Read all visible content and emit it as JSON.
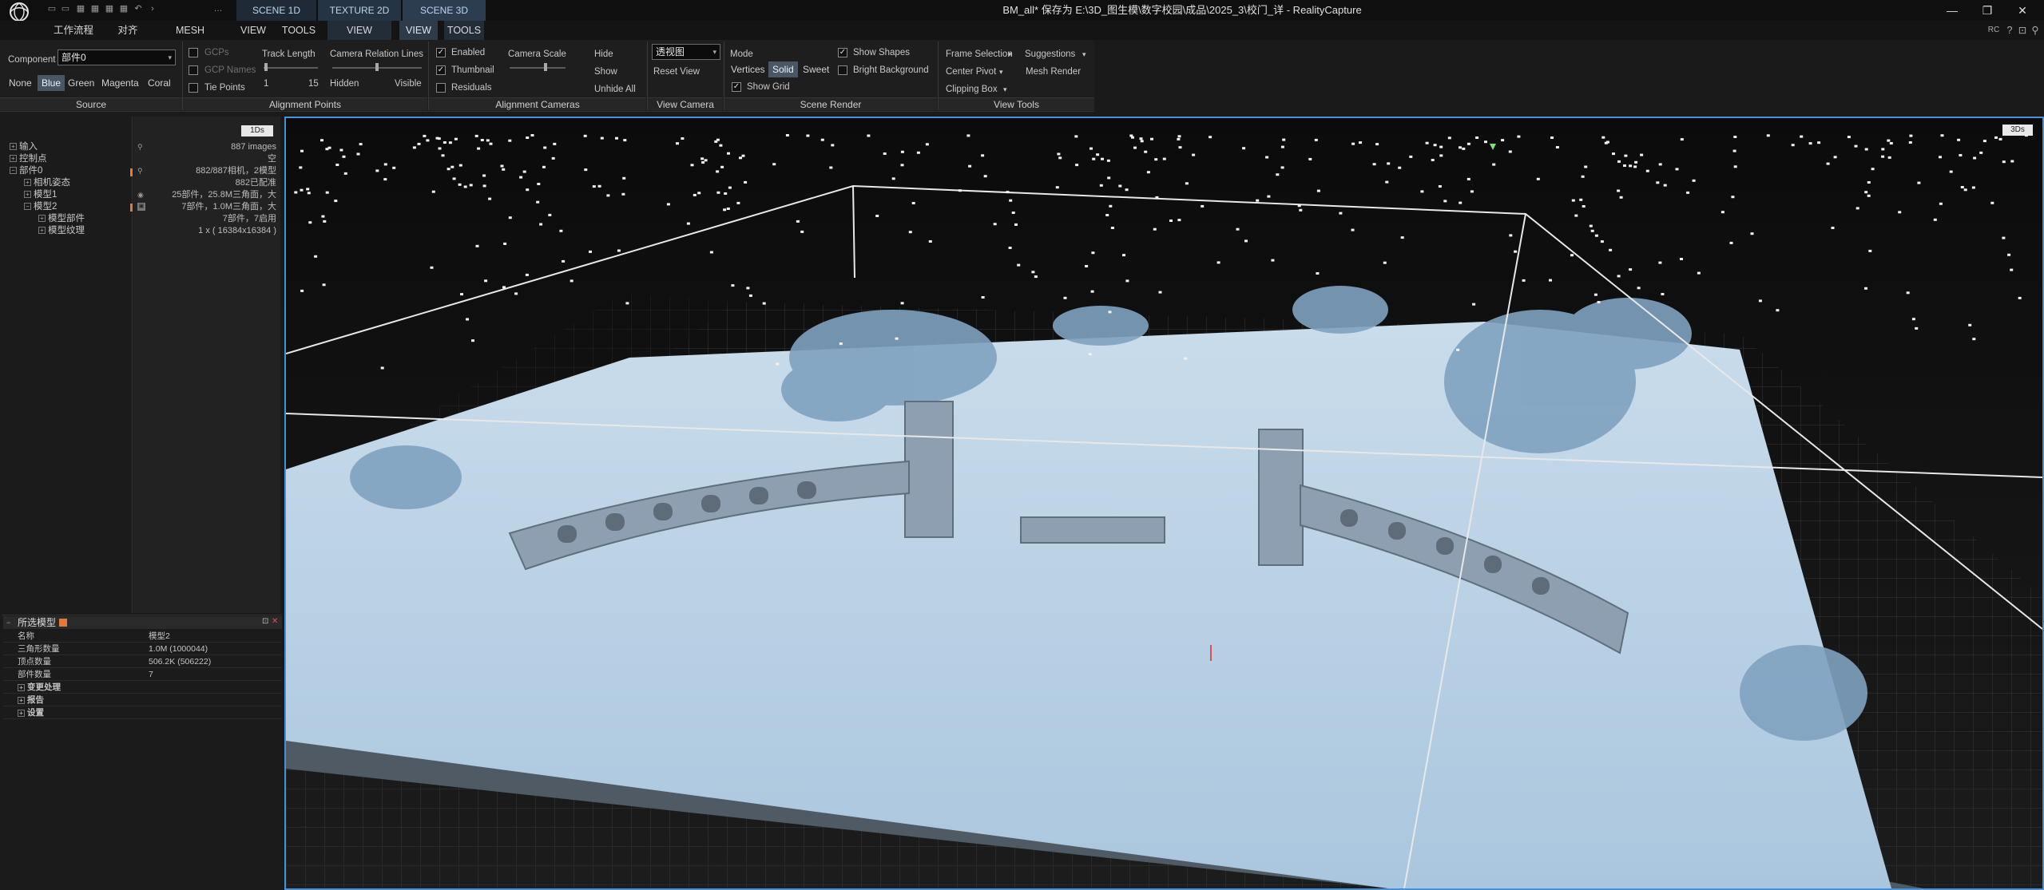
{
  "titlebar": {
    "title": "BM_all* 保存为 E:\\3D_图生模\\数字校园\\成品\\2025_3\\校门_详 - RealityCapture",
    "scene_tabs": [
      "SCENE 1D",
      "TEXTURE 2D",
      "SCENE 3D"
    ],
    "quick_access": [
      "▭",
      "▭",
      "▦",
      "▦",
      "▦",
      "▦",
      "↶",
      "›",
      "…"
    ],
    "window_buttons": [
      "—",
      "❐",
      "✕"
    ]
  },
  "menubar": {
    "items": [
      "工作流程",
      "对齐",
      "MESH MODEL",
      "VIEW",
      "TOOLS",
      "VIEW",
      "VIEW",
      "TOOLS"
    ],
    "right_icons": [
      "RC",
      "?",
      "⊡",
      "⚲"
    ]
  },
  "ribbon": {
    "source": {
      "component_label": "Component",
      "component_value": "部件0",
      "colors": [
        "None",
        "Blue",
        "Green",
        "Magenta",
        "Coral"
      ],
      "selected_color": "Blue",
      "title": "Source"
    },
    "alignment_points": {
      "gcps": "GCPs",
      "gcp_names": "GCP Names",
      "tie_points": "Tie Points",
      "track_length": "Track Length",
      "track_min": "1",
      "track_max": "15",
      "title": "Alignment Points"
    },
    "camera_relation": {
      "label": "Camera Relation Lines",
      "hidden": "Hidden",
      "visible": "Visible"
    },
    "alignment_cameras": {
      "enabled": "Enabled",
      "thumbnail": "Thumbnail",
      "residuals": "Residuals",
      "camera_scale": "Camera Scale",
      "hide": "Hide",
      "show": "Show",
      "unhide_all": "Unhide All",
      "title": "Alignment Cameras"
    },
    "view_camera": {
      "projection_value": "透视图",
      "reset_view": "Reset View",
      "title": "View Camera"
    },
    "scene_render": {
      "mode_label": "Mode",
      "modes": [
        "Vertices",
        "Solid",
        "Sweet"
      ],
      "selected_mode": "Solid",
      "show_shapes": "Show Shapes",
      "bright_background": "Bright Background",
      "show_grid": "Show Grid",
      "title": "Scene Render"
    },
    "view_tools": {
      "frame_selection": "Frame Selection",
      "suggestions": "Suggestions",
      "center_pivot": "Center Pivot",
      "mesh_render": "Mesh Render",
      "clipping_box": "Clipping Box",
      "title": "View Tools"
    }
  },
  "tree": {
    "badge": "1Ds",
    "items": [
      {
        "label": "输入",
        "expander": "+",
        "info": "887 images"
      },
      {
        "label": "控制点",
        "expander": "+",
        "info": "空"
      },
      {
        "label": "部件0",
        "expander": "−",
        "info": "882/887相机，2模型"
      },
      {
        "label": "相机姿态",
        "expander": "+",
        "info": "882已配准"
      },
      {
        "label": "模型1",
        "expander": "+",
        "info": "25部件，25.8M三角面，大"
      },
      {
        "label": "模型2",
        "expander": "−",
        "info": "7部件，1.0M三角面，大"
      },
      {
        "label": "模型部件",
        "expander": "+",
        "info": "7部件，7启用"
      },
      {
        "label": "模型纹理",
        "expander": "+",
        "info": "1 x ( 16384x16384 )"
      }
    ]
  },
  "props": {
    "title": "所选模型",
    "rows": [
      {
        "k": "名称",
        "v": "模型2"
      },
      {
        "k": "三角形数量",
        "v": "1.0M (1000044)"
      },
      {
        "k": "顶点数量",
        "v": "506.2K (506222)"
      },
      {
        "k": "部件数量",
        "v": "7"
      }
    ],
    "sections": [
      "变更处理",
      "报告",
      "设置"
    ]
  },
  "viewport": {
    "badge": "3Ds"
  },
  "colors": {
    "accent": "#4a90d9",
    "model": "#b8d4ea",
    "background": "#121212"
  }
}
